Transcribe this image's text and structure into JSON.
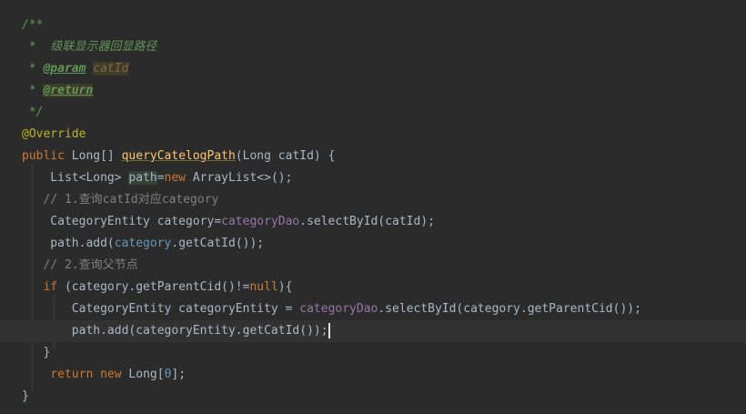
{
  "editor": {
    "lines": [
      {
        "tokens": [
          {
            "t": "/**",
            "k": "doc"
          }
        ]
      },
      {
        "tokens": [
          {
            "t": " *  ",
            "k": "doc"
          },
          {
            "t": "级联显示器回显路径",
            "k": "doc"
          }
        ]
      },
      {
        "tokens": [
          {
            "t": " * ",
            "k": "doc"
          },
          {
            "t": "@param",
            "k": "doctag"
          },
          {
            "t": " ",
            "k": "doc"
          },
          {
            "t": "catId",
            "k": "docparam"
          }
        ]
      },
      {
        "tokens": [
          {
            "t": " * ",
            "k": "doc"
          },
          {
            "t": "@return",
            "k": "doctag"
          }
        ]
      },
      {
        "tokens": [
          {
            "t": " */",
            "k": "doc"
          }
        ]
      },
      {
        "tokens": [
          {
            "t": "@Override",
            "k": "ann"
          }
        ]
      },
      {
        "tokens": [
          {
            "t": "public",
            "k": "kw"
          },
          {
            "t": " Long[] ",
            "k": "pun"
          },
          {
            "t": "queryCatelogPath",
            "k": "fn"
          },
          {
            "t": "(Long catId) {",
            "k": "pun"
          }
        ]
      },
      {
        "tokens": [
          {
            "t": "    List<Long> ",
            "k": "pun"
          },
          {
            "t": "path",
            "k": "boxed"
          },
          {
            "t": "=",
            "k": "pun"
          },
          {
            "t": "new",
            "k": "kw"
          },
          {
            "t": " ArrayList<>();",
            "k": "pun"
          }
        ]
      },
      {
        "tokens": [
          {
            "t": "   // 1.查询catId对应category",
            "k": "cmt"
          }
        ]
      },
      {
        "tokens": [
          {
            "t": "    CategoryEntity category=",
            "k": "pun"
          },
          {
            "t": "categoryDao",
            "k": "fld"
          },
          {
            "t": ".selectById(catId);",
            "k": "pun"
          }
        ]
      },
      {
        "tokens": [
          {
            "t": "    path.add(",
            "k": "pun"
          },
          {
            "t": "category",
            "k": "num"
          },
          {
            "t": ".getCatId());",
            "k": "pun"
          }
        ]
      },
      {
        "tokens": [
          {
            "t": "   // 2.查询父节点",
            "k": "cmt"
          }
        ]
      },
      {
        "tokens": [
          {
            "t": "   ",
            "k": "pun"
          },
          {
            "t": "if",
            "k": "kw"
          },
          {
            "t": " (category.getParentCid()!=",
            "k": "pun"
          },
          {
            "t": "null",
            "k": "kw"
          },
          {
            "t": "){",
            "k": "pun"
          }
        ]
      },
      {
        "tokens": [
          {
            "t": "       CategoryEntity categoryEntity = ",
            "k": "pun"
          },
          {
            "t": "categoryDao",
            "k": "fld"
          },
          {
            "t": ".selectById(category.getParentCid());",
            "k": "pun"
          }
        ]
      },
      {
        "tokens": [
          {
            "t": "       path.add(categoryEntity.getCatId());",
            "k": "pun"
          },
          {
            "t": "",
            "k": "caret"
          }
        ]
      },
      {
        "tokens": [
          {
            "t": "   }",
            "k": "pun"
          }
        ]
      },
      {
        "tokens": [
          {
            "t": "    ",
            "k": "pun"
          },
          {
            "t": "return",
            "k": "kw"
          },
          {
            "t": " ",
            "k": "pun"
          },
          {
            "t": "new",
            "k": "kw"
          },
          {
            "t": " Long[",
            "k": "pun"
          },
          {
            "t": "0",
            "k": "num"
          },
          {
            "t": "];",
            "k": "pun"
          }
        ]
      },
      {
        "tokens": [
          {
            "t": "}",
            "k": "pun"
          }
        ]
      }
    ],
    "caret_line_index": 14
  },
  "colors": {
    "background": "#2b2b2b",
    "default_text": "#a9b7c6",
    "keyword": "#cc7832",
    "doc_comment": "#629755",
    "line_comment": "#808080",
    "annotation": "#bbb529",
    "method_declaration": "#ffc66d",
    "field": "#9876aa",
    "number": "#6897bb",
    "caret_row": "#323232"
  }
}
